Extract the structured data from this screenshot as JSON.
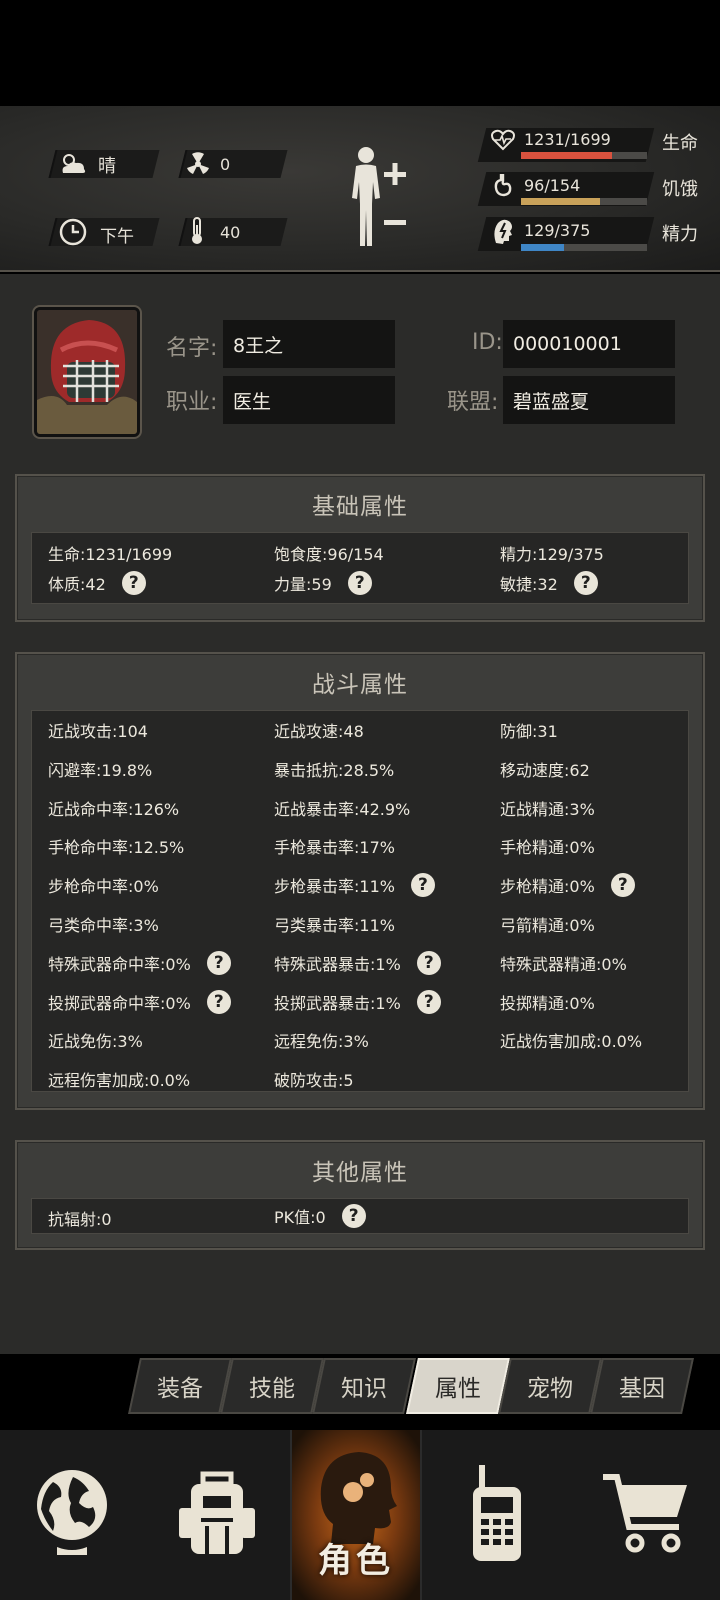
{
  "status": {
    "weather": "晴",
    "radiation": "0",
    "time_of_day": "下午",
    "temperature": "40",
    "health": {
      "value": "1231/1699",
      "label": "生命",
      "fraction": 0.7245,
      "color": "#d9523e"
    },
    "hunger": {
      "value": "96/154",
      "label": "饥饿",
      "fraction": 0.6234,
      "color": "#c9a25a"
    },
    "energy": {
      "value": "129/375",
      "label": "精力",
      "fraction": 0.344,
      "color": "#3f86c6"
    }
  },
  "profile": {
    "name_label": "名字:",
    "name": "8王之",
    "id_label": "ID:",
    "id": "000010001",
    "job_label": "职业:",
    "job": "医生",
    "alliance_label": "联盟:",
    "alliance": "碧蓝盛夏"
  },
  "basic": {
    "title": "基础属性",
    "items": [
      "生命:1231/1699",
      "饱食度:96/154",
      "精力:129/375",
      "体质:42",
      "力量:59",
      "敏捷:32"
    ]
  },
  "combat": {
    "title": "战斗属性",
    "items": [
      "近战攻击:104",
      "近战攻速:48",
      "防御:31",
      "闪避率:19.8%",
      "暴击抵抗:28.5%",
      "移动速度:62",
      "近战命中率:126%",
      "近战暴击率:42.9%",
      "近战精通:3%",
      "手枪命中率:12.5%",
      "手枪暴击率:17%",
      "手枪精通:0%",
      "步枪命中率:0%",
      "步枪暴击率:11%",
      "步枪精通:0%",
      "弓类命中率:3%",
      "弓类暴击率:11%",
      "弓箭精通:0%",
      "特殊武器命中率:0%",
      "特殊武器暴击:1%",
      "特殊武器精通:0%",
      "投掷武器命中率:0%",
      "投掷武器暴击:1%",
      "投掷精通:0%",
      "近战免伤:3%",
      "远程免伤:3%",
      "近战伤害加成:0.0%",
      "远程伤害加成:0.0%",
      "破防攻击:5"
    ]
  },
  "other": {
    "title": "其他属性",
    "items": [
      "抗辐射:0",
      "PK值:0"
    ]
  },
  "tabs": [
    "装备",
    "技能",
    "知识",
    "属性",
    "宠物",
    "基因"
  ],
  "nav": {
    "active_label": "角色"
  },
  "icons": [
    "weather-icon",
    "radiation-icon",
    "clock-icon",
    "thermometer-icon",
    "heart-icon",
    "stomach-icon",
    "energy-icon",
    "globe-icon",
    "backpack-icon",
    "radio-icon",
    "cart-icon"
  ]
}
